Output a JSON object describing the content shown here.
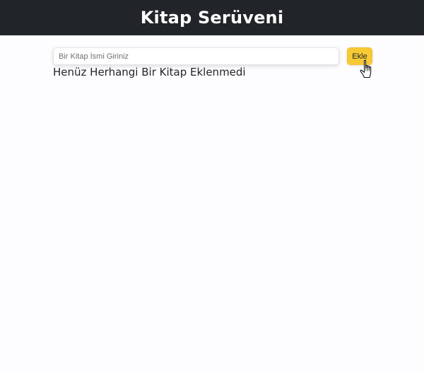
{
  "header": {
    "title": "Kitap Serüveni",
    "background_color": "#212529"
  },
  "form": {
    "input_placeholder": "Bir Kitap İsmi Giriniz",
    "input_value": "",
    "add_button_label": "Ekle",
    "add_button_color": "#f7ca35"
  },
  "book_list": {
    "empty_message": "Henüz Herhangi Bir Kitap Eklenmedi",
    "items": []
  },
  "cursor": {
    "icon": "hand-pointer-icon"
  }
}
